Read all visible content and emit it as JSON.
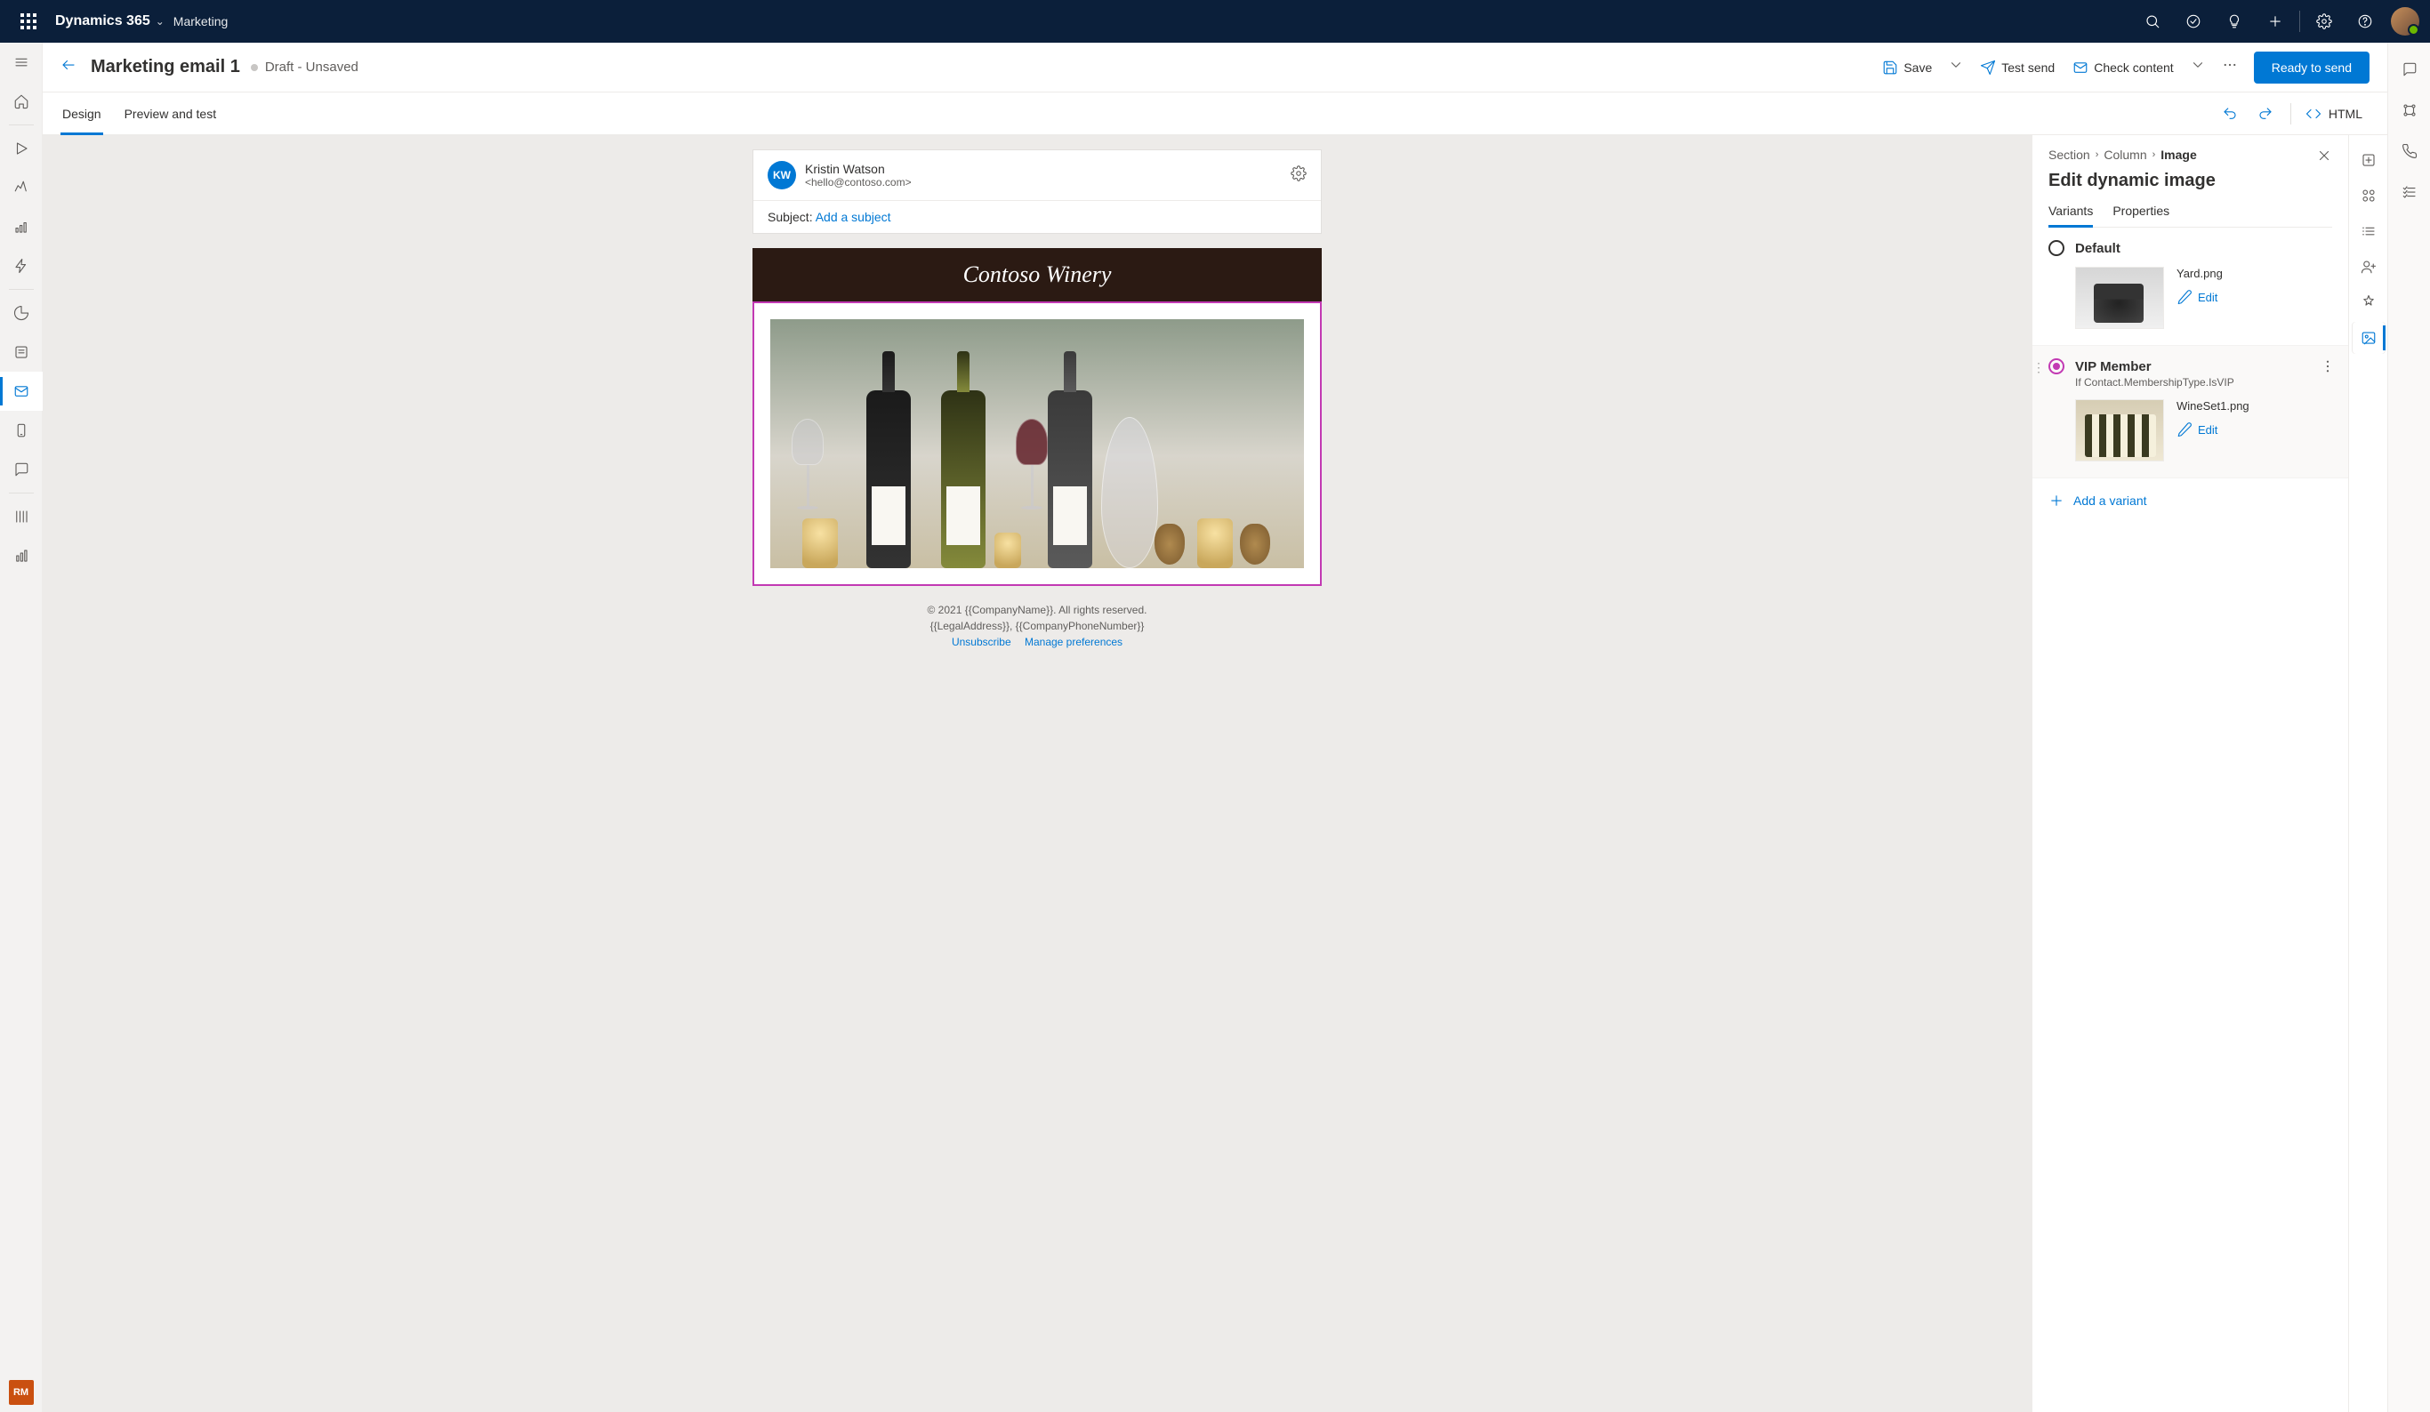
{
  "topbar": {
    "app_title": "Dynamics 365",
    "module_name": "Marketing"
  },
  "cmdbar": {
    "page_title": "Marketing email 1",
    "status_text": "Draft - Unsaved",
    "save_label": "Save",
    "test_send_label": "Test send",
    "check_content_label": "Check content",
    "primary_label": "Ready to send"
  },
  "tabs": {
    "design": "Design",
    "preview": "Preview and test",
    "html_label": "HTML"
  },
  "sender": {
    "avatar": "KW",
    "name": "Kristin Watson",
    "email": "<hello@contoso.com>"
  },
  "subject": {
    "prefix": "Subject: ",
    "placeholder": "Add a subject"
  },
  "banner": {
    "title": "Contoso Winery"
  },
  "footer": {
    "line1": "© 2021 {{CompanyName}}. All rights reserved.",
    "line2": "{{LegalAddress}}, {{CompanyPhoneNumber}}",
    "unsubscribe": "Unsubscribe",
    "manage": "Manage preferences"
  },
  "panel": {
    "breadcrumb": {
      "a": "Section",
      "b": "Column",
      "c": "Image"
    },
    "title": "Edit dynamic image",
    "tabs": {
      "variants": "Variants",
      "properties": "Properties"
    },
    "variants": [
      {
        "name": "Default",
        "file": "Yard.png",
        "edit": "Edit",
        "selected": false
      },
      {
        "name": "VIP Member",
        "condition": "If Contact.MembershipType.IsVIP",
        "file": "WineSet1.png",
        "edit": "Edit",
        "selected": true
      }
    ],
    "add_variant": "Add a variant"
  },
  "left_rail_badge": "RM"
}
